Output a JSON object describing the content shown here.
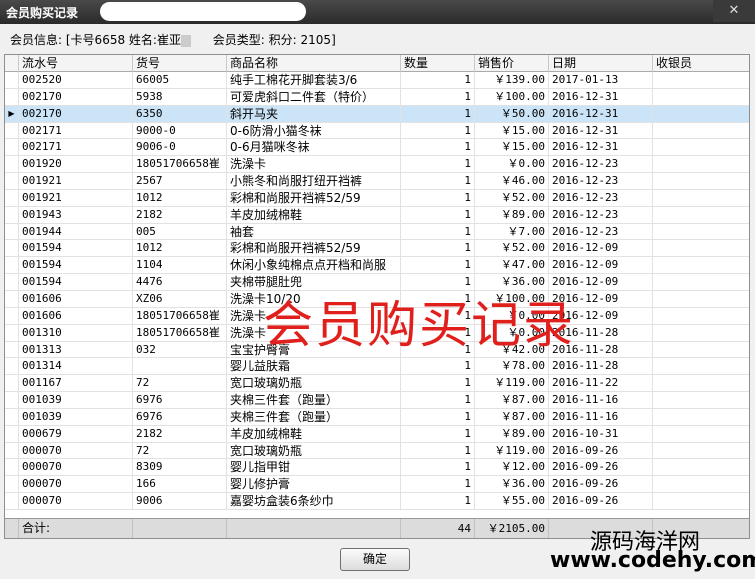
{
  "window": {
    "title": "会员购买记录",
    "close": "✕"
  },
  "info": {
    "member_label": "会员信息:",
    "member_value": "[卡号6658 姓名:崔亚",
    "type_label": "会员类型:",
    "points": "积分: 2105]"
  },
  "columns": [
    "流水号",
    "货号",
    "商品名称",
    "数量",
    "销售价",
    "日期",
    "收银员"
  ],
  "rows": [
    [
      "002520",
      "66005",
      "纯手工棉花开脚套装3/6",
      "1",
      "￥139.00",
      "2017-01-13",
      ""
    ],
    [
      "002170",
      "5938",
      "可爱虎斜口二件套（特价）",
      "1",
      "￥100.00",
      "2016-12-31",
      ""
    ],
    [
      "002170",
      "6350",
      "斜开马夹",
      "1",
      "￥50.00",
      "2016-12-31",
      ""
    ],
    [
      "002171",
      "9000-0",
      "0-6防滑小猫冬袜",
      "1",
      "￥15.00",
      "2016-12-31",
      ""
    ],
    [
      "002171",
      "9006-0",
      "0-6月猫咪冬袜",
      "1",
      "￥15.00",
      "2016-12-31",
      ""
    ],
    [
      "001920",
      "18051706658崔",
      "洗澡卡",
      "1",
      "￥0.00",
      "2016-12-23",
      ""
    ],
    [
      "001921",
      "2567",
      "小熊冬和尚服打纽开裆裤",
      "1",
      "￥46.00",
      "2016-12-23",
      ""
    ],
    [
      "001921",
      "1012",
      "彩棉和尚服开裆裤52/59",
      "1",
      "￥52.00",
      "2016-12-23",
      ""
    ],
    [
      "001943",
      "2182",
      "羊皮加绒棉鞋",
      "1",
      "￥89.00",
      "2016-12-23",
      ""
    ],
    [
      "001944",
      "005",
      "袖套",
      "1",
      "￥7.00",
      "2016-12-23",
      ""
    ],
    [
      "001594",
      "1012",
      "彩棉和尚服开裆裤52/59",
      "1",
      "￥52.00",
      "2016-12-09",
      ""
    ],
    [
      "001594",
      "1104",
      "休闲小象纯棉点点开档和尚服",
      "1",
      "￥47.00",
      "2016-12-09",
      ""
    ],
    [
      "001594",
      "4476",
      "夹棉带腿肚兜",
      "1",
      "￥36.00",
      "2016-12-09",
      ""
    ],
    [
      "001606",
      "XZ06",
      "洗澡卡10/20",
      "1",
      "￥100.00",
      "2016-12-09",
      ""
    ],
    [
      "001606",
      "18051706658崔",
      "洗澡卡",
      "1",
      "￥0.00",
      "2016-12-09",
      ""
    ],
    [
      "001310",
      "18051706658崔",
      "洗澡卡",
      "1",
      "￥0.00",
      "2016-11-28",
      ""
    ],
    [
      "001313",
      "032",
      "宝宝护臀膏",
      "1",
      "￥42.00",
      "2016-11-28",
      ""
    ],
    [
      "001314",
      "",
      "婴儿益肤霜",
      "1",
      "￥78.00",
      "2016-11-28",
      ""
    ],
    [
      "001167",
      "72",
      "宽口玻璃奶瓶",
      "1",
      "￥119.00",
      "2016-11-22",
      ""
    ],
    [
      "001039",
      "6976",
      "夹棉三件套（跑量）",
      "1",
      "￥87.00",
      "2016-11-16",
      ""
    ],
    [
      "001039",
      "6976",
      "夹棉三件套（跑量）",
      "1",
      "￥87.00",
      "2016-11-16",
      ""
    ],
    [
      "000679",
      "2182",
      "羊皮加绒棉鞋",
      "1",
      "￥89.00",
      "2016-10-31",
      ""
    ],
    [
      "000070",
      "72",
      "宽口玻璃奶瓶",
      "1",
      "￥119.00",
      "2016-09-26",
      ""
    ],
    [
      "000070",
      "8309",
      "婴儿指甲钳",
      "1",
      "￥12.00",
      "2016-09-26",
      ""
    ],
    [
      "000070",
      "166",
      "婴儿修护膏",
      "1",
      "￥36.00",
      "2016-09-26",
      ""
    ],
    [
      "000070",
      "9006",
      "嘉婴坊盒装6条纱巾",
      "1",
      "￥55.00",
      "2016-09-26",
      ""
    ]
  ],
  "selected_row": 2,
  "total": {
    "label": "合计:",
    "qty": "44",
    "amount": "￥2105.00"
  },
  "ok_button": "确定",
  "watermark": "会员购买记录",
  "logo": {
    "line1": "源码海洋网",
    "line2": "www.codehy.com"
  }
}
